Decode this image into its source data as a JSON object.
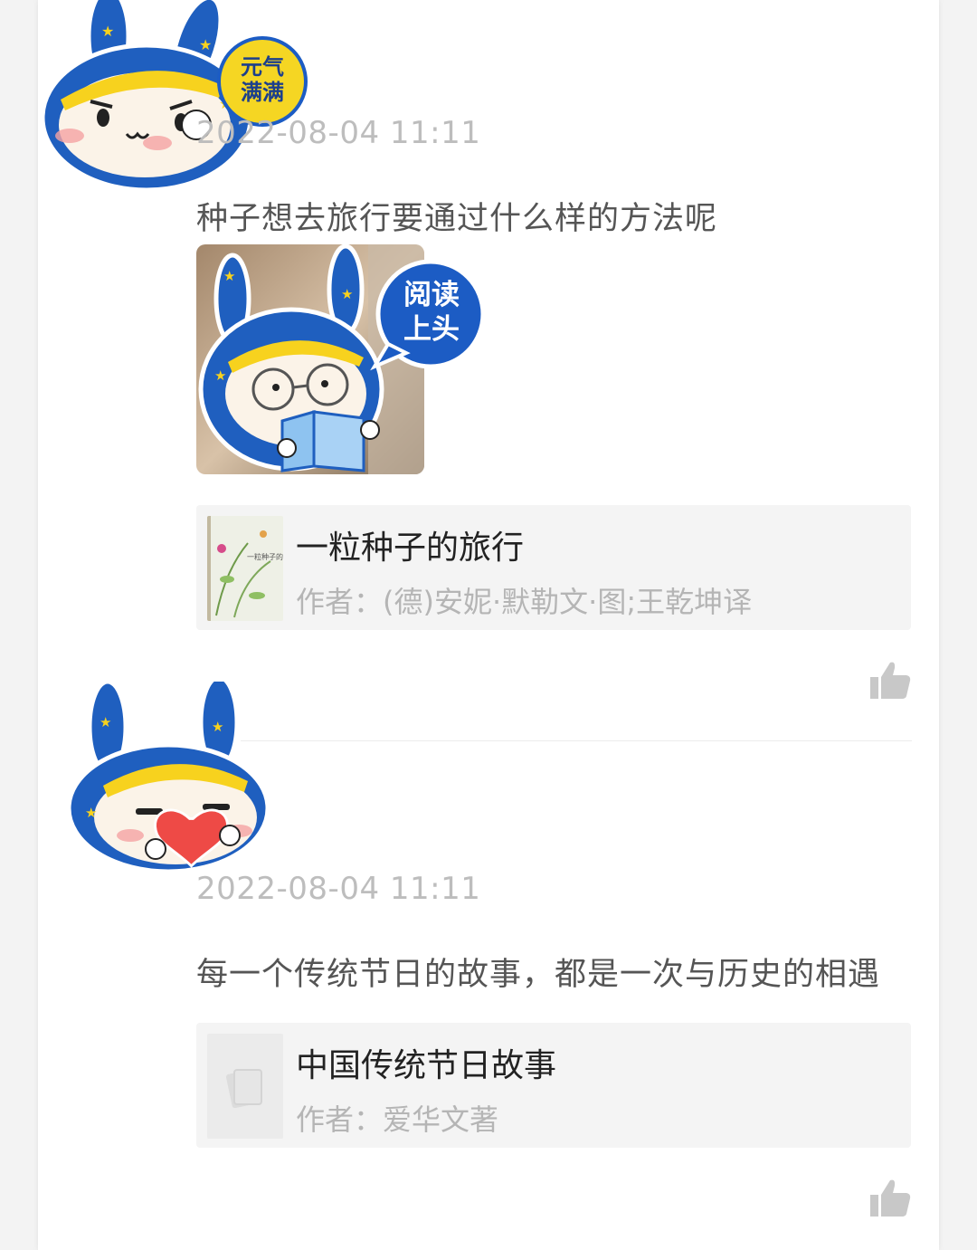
{
  "comments": [
    {
      "avatar_sticker_text": [
        "元气",
        "满满"
      ],
      "timestamp": "2022-08-04 11:11",
      "text": "种子想去旅行要通过什么样的方法呢",
      "photo_sticker_text": [
        "阅读",
        "上头"
      ],
      "book": {
        "title": "一粒种子的旅行",
        "author": "作者：(德)安妮·默勒文·图;王乾坤译",
        "cover_text": "一粒种子的旅行"
      },
      "like_icon": "thumbs-up-icon"
    },
    {
      "timestamp": "2022-08-04 11:11",
      "text": "每一个传统节日的故事，都是一次与历史的相遇",
      "book": {
        "title": "中国传统节日故事",
        "author": "作者：爱华文著",
        "cover_icon": "book-placeholder-icon"
      },
      "like_icon": "thumbs-up-icon"
    }
  ],
  "colors": {
    "mascot_blue": "#1f5fbf",
    "mascot_yellow": "#f7d21e",
    "badge_yellow": "#f5d623",
    "badge_blue": "#1c5cc4",
    "heart_red": "#ee4a46",
    "muted_text": "#bdbdbd",
    "body_text": "#555555"
  }
}
